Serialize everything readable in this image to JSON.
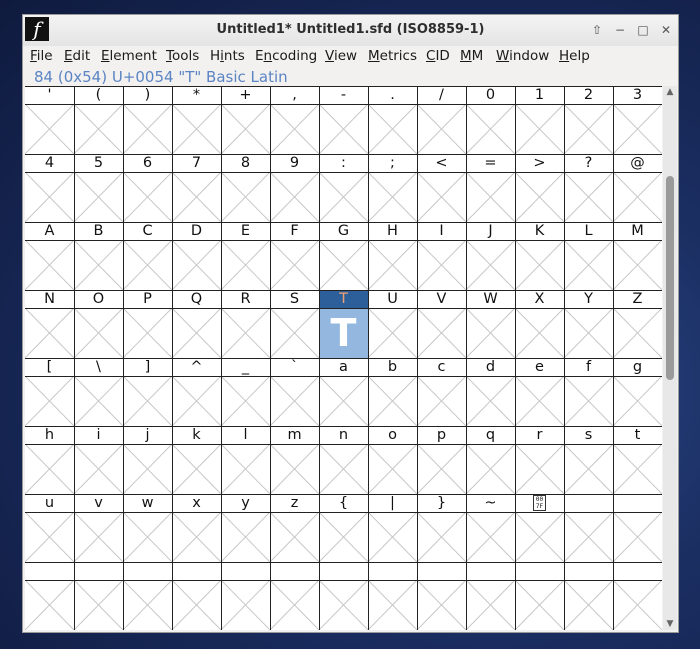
{
  "window": {
    "title": "Untitled1*  Untitled1.sfd (ISO8859-1)",
    "app_icon_glyph": "f"
  },
  "controls": {
    "up": "⇧",
    "minimize": "−",
    "maximize": "□",
    "close": "✕"
  },
  "menu": [
    "File",
    "Edit",
    "Element",
    "Tools",
    "Hints",
    "Encoding",
    "View",
    "Metrics",
    "CID",
    "MM",
    "Window",
    "Help"
  ],
  "menu_mnemonics": [
    0,
    0,
    0,
    0,
    1,
    1,
    0,
    0,
    0,
    0,
    0,
    0
  ],
  "info_line": "84 (0x54) U+0054 \"T\" Basic Latin",
  "rows": [
    [
      "'",
      "(",
      ")",
      "*",
      "+",
      ",",
      "-",
      ".",
      "/",
      "0",
      "1",
      "2",
      "3"
    ],
    [
      "4",
      "5",
      "6",
      "7",
      "8",
      "9",
      ":",
      ";",
      "<",
      "=",
      ">",
      "?",
      "@"
    ],
    [
      "A",
      "B",
      "C",
      "D",
      "E",
      "F",
      "G",
      "H",
      "I",
      "J",
      "K",
      "L",
      "M"
    ],
    [
      "N",
      "O",
      "P",
      "Q",
      "R",
      "S",
      "T",
      "U",
      "V",
      "W",
      "X",
      "Y",
      "Z"
    ],
    [
      "[",
      "\\",
      "]",
      "^",
      "_",
      "`",
      "a",
      "b",
      "c",
      "d",
      "e",
      "f",
      "g"
    ],
    [
      "h",
      "i",
      "j",
      "k",
      "l",
      "m",
      "n",
      "o",
      "p",
      "q",
      "r",
      "s",
      "t"
    ],
    [
      "u",
      "v",
      "w",
      "x",
      "y",
      "z",
      "{",
      "|",
      "}",
      "~",
      "",
      "",
      ""
    ],
    [
      "",
      "",
      "",
      "",
      "",
      "",
      "",
      "",
      "",
      "",
      "",
      "",
      ""
    ]
  ],
  "unknown_glyph": {
    "row": 6,
    "col": 10,
    "top": "00",
    "bottom": "7F"
  },
  "selected": {
    "row": 3,
    "col": 6,
    "glyph": "T"
  },
  "colors": {
    "info": "#5b84c4",
    "selected_label_bg": "#2d5f9a",
    "selected_box_bg": "#93b7de"
  },
  "scrollbar": {
    "up": "▲",
    "down": "▼"
  }
}
